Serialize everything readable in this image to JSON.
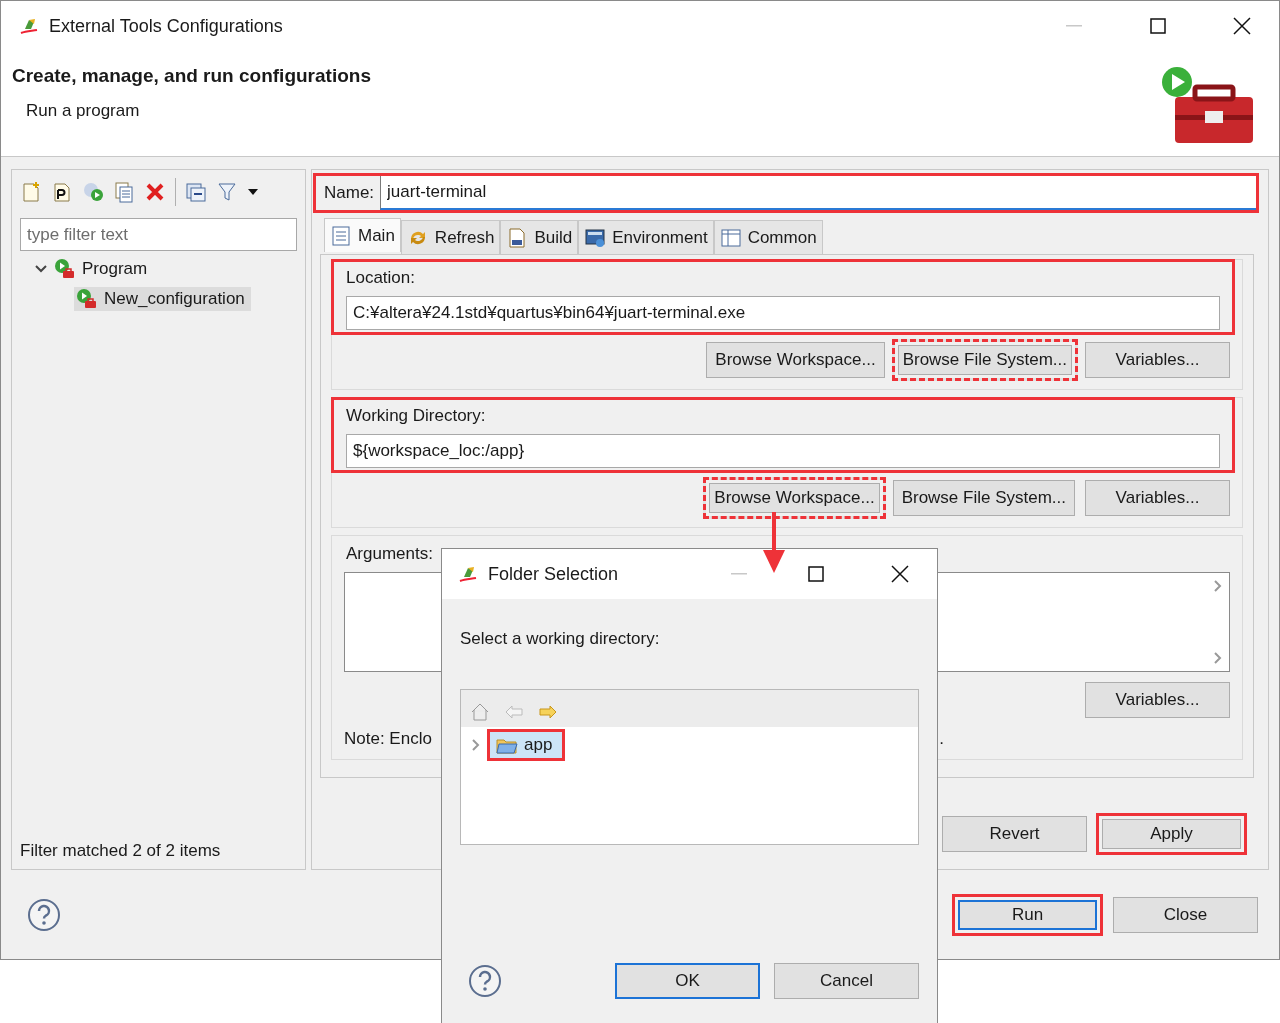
{
  "window": {
    "title": "External Tools Configurations"
  },
  "header": {
    "title": "Create, manage, and run configurations",
    "subtitle": "Run a program"
  },
  "filter": {
    "placeholder": "type filter text"
  },
  "tree": [
    {
      "label": "Program",
      "expanded": true,
      "selected": false,
      "children": [
        {
          "label": "New_configuration",
          "selected": true
        }
      ]
    }
  ],
  "filter_status": "Filter matched 2 of 2 items",
  "name_field": {
    "label": "Name:",
    "value": "juart-terminal",
    "highlighted": true
  },
  "tabs": [
    {
      "label": "Main",
      "selected": true
    },
    {
      "label": "Refresh",
      "selected": false
    },
    {
      "label": "Build",
      "selected": false
    },
    {
      "label": "Environment",
      "selected": false
    },
    {
      "label": "Common",
      "selected": false
    }
  ],
  "groups": [
    {
      "label": "Location:",
      "value": "C:¥altera¥24.1std¥quartus¥bin64¥juart-terminal.exe",
      "highlighted": true,
      "buttons": [
        {
          "label": "Browse Workspace...",
          "highlighted": false
        },
        {
          "label": "Browse File System...",
          "highlighted": true
        },
        {
          "label": "Variables...",
          "highlighted": false
        }
      ]
    },
    {
      "label": "Working Directory:",
      "value": "${workspace_loc:/app}",
      "highlighted": true,
      "buttons": [
        {
          "label": "Browse Workspace...",
          "highlighted": true
        },
        {
          "label": "Browse File System...",
          "highlighted": false
        },
        {
          "label": "Variables...",
          "highlighted": false
        }
      ]
    }
  ],
  "arguments": {
    "label": "Arguments:",
    "buttons": [
      {
        "label": "Variables..."
      }
    ],
    "note_start": "Note: Enclo",
    "note_end": "."
  },
  "action_buttons": [
    {
      "label": "Revert",
      "highlighted": false
    },
    {
      "label": "Apply",
      "highlighted": true
    }
  ],
  "footer_buttons": [
    {
      "label": "Run",
      "highlighted": true,
      "default": true
    },
    {
      "label": "Close",
      "highlighted": false,
      "default": false
    }
  ],
  "folder_dialog": {
    "title": "Folder Selection",
    "prompt": "Select a working directory:",
    "items": [
      {
        "label": "app",
        "selected": true,
        "expanded": false,
        "highlighted": true
      }
    ],
    "buttons": [
      {
        "label": "OK",
        "default": true
      },
      {
        "label": "Cancel",
        "default": false
      }
    ]
  }
}
